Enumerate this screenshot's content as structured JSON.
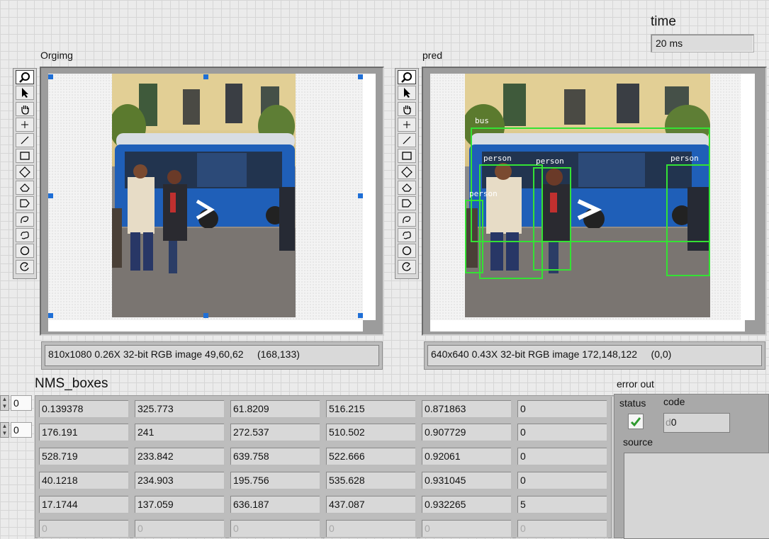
{
  "time": {
    "label": "time",
    "value": "20 ms"
  },
  "displays": {
    "orig": {
      "label": "Orgimg",
      "status": "810x1080 0.26X 32-bit RGB image 49,60,62     (168,133)"
    },
    "pred": {
      "label": "pred",
      "status": "640x640 0.43X 32-bit RGB image 172,148,122     (0,0)",
      "detections": [
        {
          "label": "bus"
        },
        {
          "label": "person"
        },
        {
          "label": "person"
        },
        {
          "label": "person"
        },
        {
          "label": "person"
        }
      ]
    }
  },
  "tools": [
    "zoom-icon",
    "pointer-icon",
    "pan-hand-icon",
    "point-icon",
    "line-icon",
    "rectangle-icon",
    "rotated-rectangle-icon",
    "annulus-icon",
    "polygon-icon",
    "freehand-icon",
    "broken-line-icon",
    "oval-icon",
    "rotated-oval-icon"
  ],
  "nms": {
    "label": "NMS_boxes",
    "index_row": "0",
    "index_col": "0",
    "rows": [
      [
        "0.139378",
        "325.773",
        "61.8209",
        "516.215",
        "0.871863",
        "0"
      ],
      [
        "176.191",
        "241",
        "272.537",
        "510.502",
        "0.907729",
        "0"
      ],
      [
        "528.719",
        "233.842",
        "639.758",
        "522.666",
        "0.92061",
        "0"
      ],
      [
        "40.1218",
        "234.903",
        "195.756",
        "535.628",
        "0.931045",
        "0"
      ],
      [
        "17.1744",
        "137.059",
        "636.187",
        "437.087",
        "0.932265",
        "5"
      ],
      [
        "0",
        "0",
        "0",
        "0",
        "0",
        "0"
      ]
    ]
  },
  "error_out": {
    "label": "error out",
    "status_label": "status",
    "code_label": "code",
    "code_prefix": "d",
    "code_value": "0",
    "source_label": "source"
  },
  "colors": {
    "detection_box": "#34e234",
    "selection_handle": "#1f6fd6"
  }
}
